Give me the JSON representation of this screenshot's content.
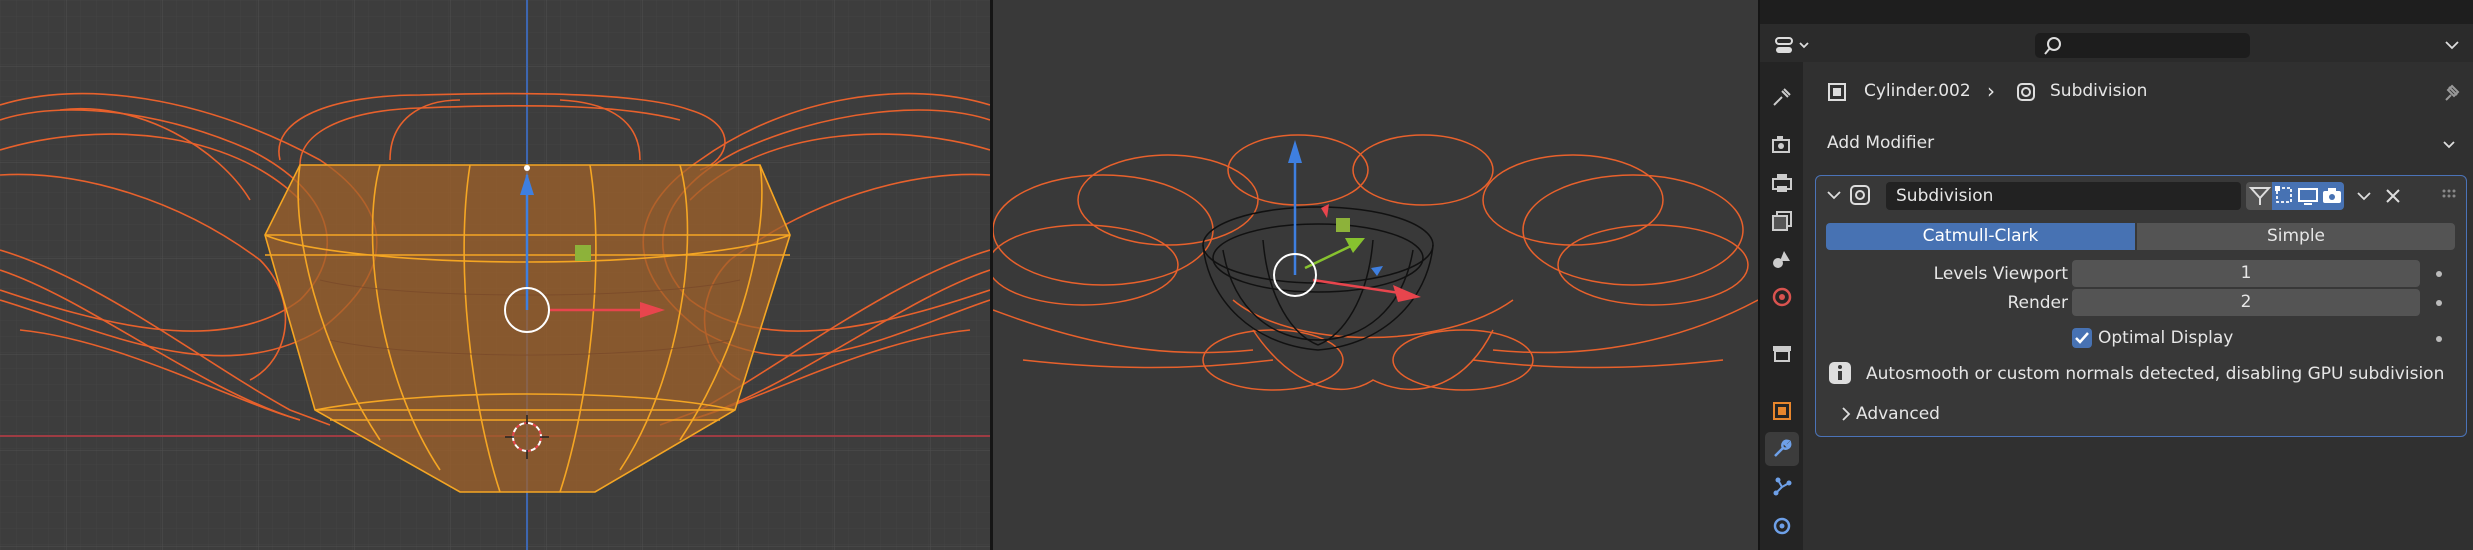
{
  "properties": {
    "search_placeholder": "",
    "breadcrumb": {
      "object": "Cylinder.002",
      "separator": "›",
      "modifier": "Subdivision"
    },
    "add_modifier_label": "Add Modifier",
    "modifier": {
      "name": "Subdivision",
      "mode_options": [
        "Catmull-Clark",
        "Simple"
      ],
      "mode_selected": "Catmull-Clark",
      "levels_viewport_label": "Levels Viewport",
      "levels_viewport_value": "1",
      "render_label": "Render",
      "render_value": "2",
      "optimal_display_label": "Optimal Display",
      "optimal_display_checked": true,
      "info_message": "Autosmooth or custom normals detected, disabling GPU subdivision",
      "advanced_label": "Advanced"
    },
    "tabs": [
      "tool",
      "render",
      "output",
      "view-layer",
      "scene",
      "world",
      "collection",
      "object",
      "modifiers",
      "particles",
      "physics"
    ],
    "active_tab": "modifiers"
  },
  "colors": {
    "accent_blue": "#4772b3",
    "wire_orange": "#e8612c",
    "selected_orange": "#f5a623",
    "x_axis": "#e8454d",
    "y_axis": "#87c22f",
    "z_axis": "#3e7fe0"
  }
}
